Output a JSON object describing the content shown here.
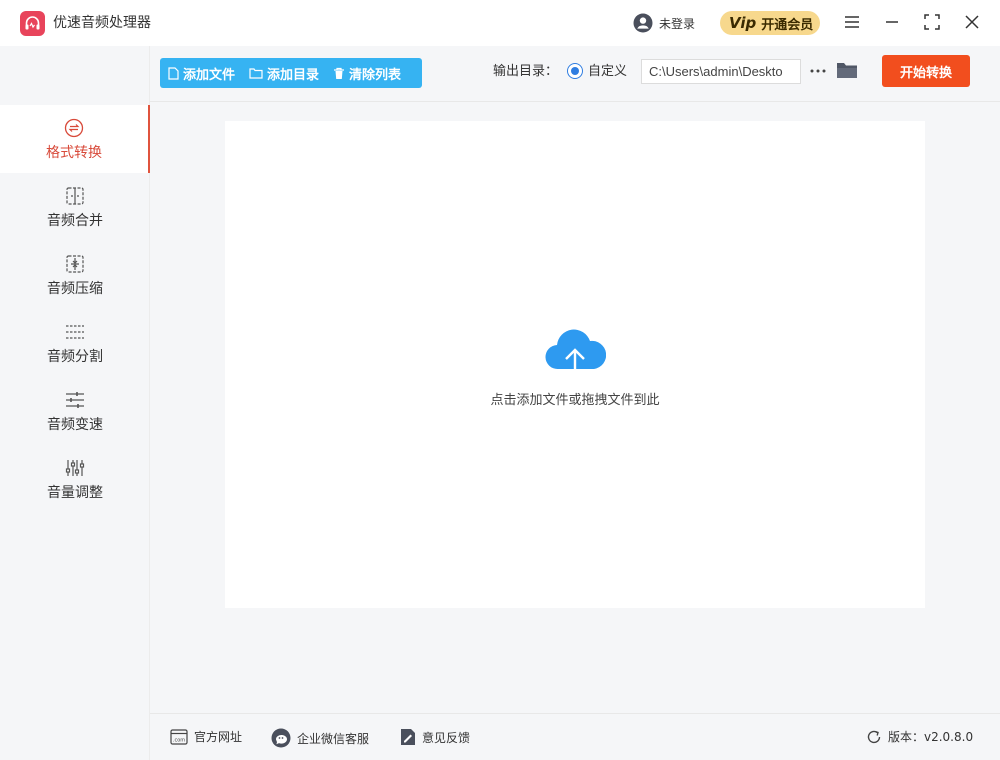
{
  "app": {
    "title": "优速音频处理器"
  },
  "titlebar": {
    "login_label": "未登录",
    "vip_badge": "Vip",
    "vip_label": "开通会员"
  },
  "colors": {
    "accent_red": "#f24e1e",
    "tool_blue": "#36b3f2",
    "vip_gold": "#f7d88d",
    "active_text": "#d84a3a",
    "cloud_blue": "#2e9af0"
  },
  "sidebar": {
    "items": [
      {
        "label": "格式转换",
        "icon": "format-convert-icon",
        "active": true
      },
      {
        "label": "音频合并",
        "icon": "merge-icon",
        "active": false
      },
      {
        "label": "音频压缩",
        "icon": "compress-icon",
        "active": false
      },
      {
        "label": "音频分割",
        "icon": "split-icon",
        "active": false
      },
      {
        "label": "音频变速",
        "icon": "speed-icon",
        "active": false
      },
      {
        "label": "音量调整",
        "icon": "volume-icon",
        "active": false
      }
    ]
  },
  "toolbar": {
    "add_file": "添加文件",
    "add_folder": "添加目录",
    "clear_list": "清除列表",
    "output_label": "输出目录：",
    "radio_label": "自定义",
    "path_value": "C:\\Users\\admin\\Deskto",
    "start_label": "开始转换"
  },
  "dropzone": {
    "hint": "点击添加文件或拖拽文件到此"
  },
  "footer": {
    "website": "官方网址",
    "wechat": "企业微信客服",
    "feedback": "意见反馈",
    "version": "版本：v2.0.8.0"
  }
}
